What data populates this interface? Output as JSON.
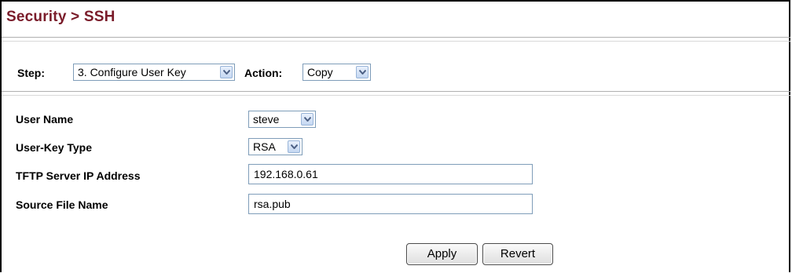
{
  "header": {
    "title": "Security > SSH"
  },
  "toolbar": {
    "step_label": "Step:",
    "step_value": "3. Configure User Key",
    "action_label": "Action:",
    "action_value": "Copy"
  },
  "form": {
    "user_name_label": "User Name",
    "user_name_value": "steve",
    "key_type_label": "User-Key Type",
    "key_type_value": "RSA",
    "tftp_label": "TFTP Server IP Address",
    "tftp_value": "192.168.0.61",
    "source_file_label": "Source File Name",
    "source_file_value": "rsa.pub"
  },
  "buttons": {
    "apply": "Apply",
    "revert": "Revert"
  },
  "colors": {
    "title": "#7a1c2a",
    "input_border": "#7f9db9"
  }
}
